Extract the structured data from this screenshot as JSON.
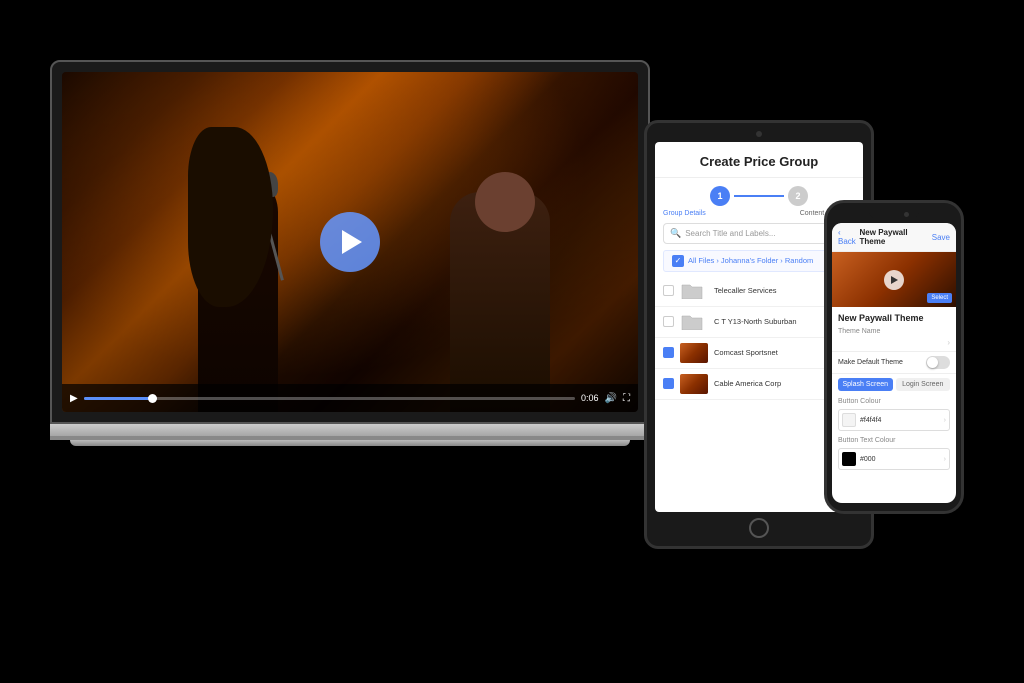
{
  "scene": {
    "background": "#000000"
  },
  "laptop": {
    "video": {
      "alt": "Concert video with singer and guitarist"
    },
    "controls": {
      "play_label": "▶",
      "time": "0:06",
      "volume_label": "🔊",
      "fullscreen_label": "⛶"
    },
    "play_button_label": "Play"
  },
  "tablet": {
    "ui": {
      "title": "Create Price Group",
      "step1_label": "Group Details",
      "step2_label": "Content Selection",
      "search_placeholder": "Search Title and Labels...",
      "breadcrumb_text": "All Files › Johanna's Folder › Random",
      "files": [
        {
          "name": "Telecaller Services",
          "type": "folder",
          "checked": false
        },
        {
          "name": "C T Y13-North Suburban",
          "type": "folder",
          "checked": false
        },
        {
          "name": "Comcast Sportsnet",
          "type": "video",
          "checked": true
        },
        {
          "name": "Cable America Corp",
          "type": "video",
          "checked": true
        }
      ]
    }
  },
  "phone": {
    "ui": {
      "back_label": "‹ Back",
      "title": "New Paywall Theme",
      "save_label": "Save",
      "section_title": "New Paywall Theme",
      "theme_name_label": "Theme Name",
      "theme_name_value": "",
      "default_theme_label": "Make Default Theme",
      "splash_screen_tab": "Splash Screen",
      "login_screen_tab": "Login Screen",
      "button_colour_label": "Button Colour",
      "button_colour_value": "#f4f4f4",
      "button_text_colour_label": "Button Text Colour",
      "button_text_colour_value": "#000"
    }
  }
}
